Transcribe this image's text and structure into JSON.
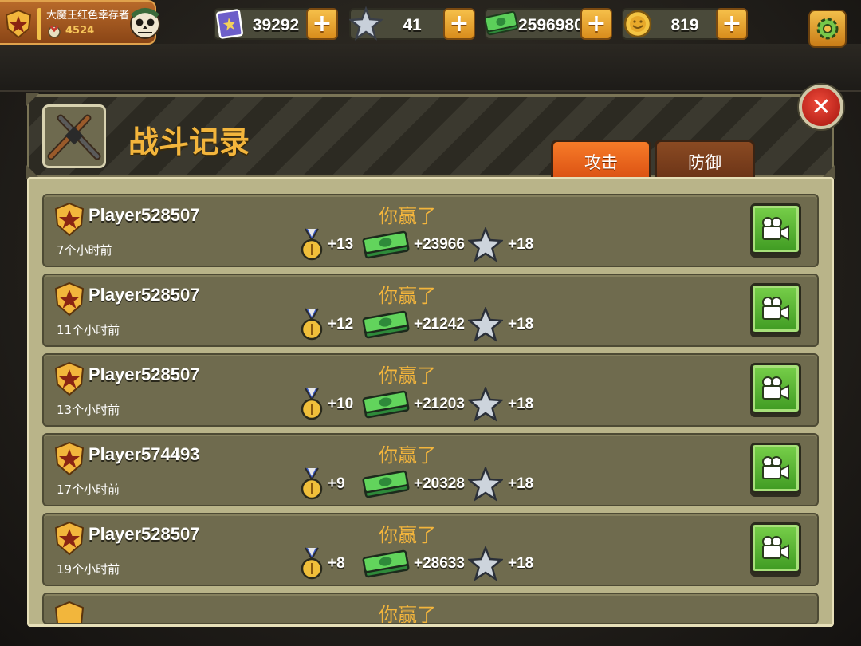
{
  "player": {
    "name": "大魔王红色幸存者",
    "score": "4524"
  },
  "resources": [
    {
      "name": "book",
      "value": "39292"
    },
    {
      "name": "star",
      "value": "41"
    },
    {
      "name": "cash",
      "value": "2596980"
    },
    {
      "name": "gold-coin",
      "value": "819"
    }
  ],
  "plus_label": "+",
  "panel": {
    "title": "战斗记录",
    "close_label": "✕",
    "tabs": [
      {
        "label": "攻击",
        "active": true
      },
      {
        "label": "防御",
        "active": false
      }
    ]
  },
  "records": [
    {
      "player": "Player528507",
      "time": "7个小时前",
      "result": "你赢了",
      "medals": "+13",
      "cash": "+23966",
      "stars": "+18"
    },
    {
      "player": "Player528507",
      "time": "11个小时前",
      "result": "你赢了",
      "medals": "+12",
      "cash": "+21242",
      "stars": "+18"
    },
    {
      "player": "Player528507",
      "time": "13个小时前",
      "result": "你赢了",
      "medals": "+10",
      "cash": "+21203",
      "stars": "+18"
    },
    {
      "player": "Player574493",
      "time": "17个小时前",
      "result": "你赢了",
      "medals": "+9",
      "cash": "+20328",
      "stars": "+18"
    },
    {
      "player": "Player528507",
      "time": "19个小时前",
      "result": "你赢了",
      "medals": "+8",
      "cash": "+28633",
      "stars": "+18"
    }
  ],
  "partial_record": {
    "result": "你赢了"
  },
  "colors": {
    "accent_orange": "#f3b53c",
    "tab_active": "#f77b28",
    "video_green": "#5bb534",
    "row_bg": "#6f6b4e"
  }
}
